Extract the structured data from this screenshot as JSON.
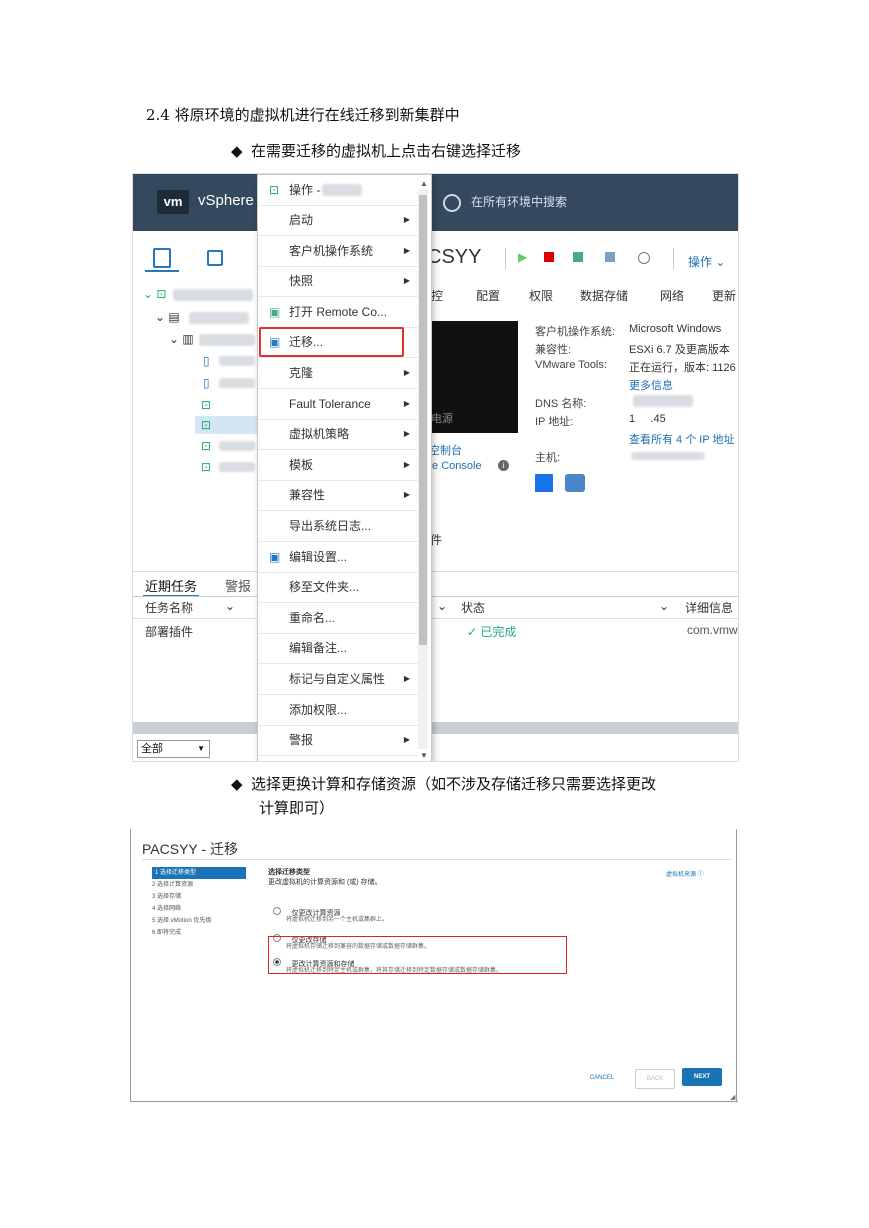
{
  "doc": {
    "heading": "2.4 将原环境的虚拟机进行在线迁移到新集群中",
    "bullet1": "在需要迁移的虚拟机上点击右键选择迁移",
    "bullet2_line1": "选择更换计算和存储资源（如不涉及存储迁移只需要选择更改",
    "bullet2_line2": "计算即可）",
    "bullet_glyph": "◆"
  },
  "shot1": {
    "app": "vSphere",
    "logo": "vm",
    "search_placeholder": "在所有环境中搜索",
    "vm_name": "CSYY",
    "ops_label": "操作 ⌄",
    "tabs": [
      "控",
      "配置",
      "权限",
      "数据存储",
      "网络",
      "更新"
    ],
    "info": {
      "os_label": "客户机操作系统:",
      "os_value": "Microsoft Windows",
      "compat_label": "兼容性:",
      "compat_value": "ESXi 6.7 及更高版本",
      "tools_label": "VMware Tools:",
      "tools_value": "正在运行，版本: 1126",
      "more_info": "更多信息",
      "dns_label": "DNS 名称:",
      "ip_label": "IP 地址:",
      "ip_value": "1     .45",
      "view_all_ip": "查看所有 4 个 IP 地址",
      "host_label": "主机:",
      "power_frag": "电源",
      "console_frag1": "空制台",
      "console_frag2": "te Console",
      "fragment_file": "件"
    },
    "recent_tasks": {
      "tab1": "近期任务",
      "tab2": "警报",
      "col_task": "任务名称",
      "col_status": "状态",
      "col_detail": "详细信息",
      "row_task": "部署插件",
      "row_status": "✓ 已完成",
      "row_detail": "com.vmwa",
      "filter": "全部"
    },
    "context_menu": {
      "header": "操作 -",
      "items": [
        {
          "label": "启动",
          "sub": true
        },
        {
          "label": "客户机操作系统",
          "sub": true
        },
        {
          "label": "快照",
          "sub": true
        },
        {
          "label": "打开 Remote Co...",
          "sub": false
        },
        {
          "label": "迁移...",
          "sub": false
        },
        {
          "label": "克隆",
          "sub": true
        },
        {
          "label": "Fault Tolerance",
          "sub": true
        },
        {
          "label": "虚拟机策略",
          "sub": true
        },
        {
          "label": "模板",
          "sub": true
        },
        {
          "label": "兼容性",
          "sub": true
        },
        {
          "label": "导出系统日志...",
          "sub": false
        },
        {
          "label": "编辑设置...",
          "sub": false
        },
        {
          "label": "移至文件夹...",
          "sub": false
        },
        {
          "label": "重命名...",
          "sub": false
        },
        {
          "label": "编辑备注...",
          "sub": false
        },
        {
          "label": "标记与自定义属性",
          "sub": true
        },
        {
          "label": "添加权限...",
          "sub": false
        },
        {
          "label": "警报",
          "sub": true
        }
      ]
    }
  },
  "shot2": {
    "title": "PACSYY - 迁移",
    "steps": [
      "1 选择迁移类型",
      "2 选择计算资源",
      "3 选择存储",
      "4 选择网络",
      "5 选择 vMotion 优先级",
      "6 即将完成"
    ],
    "section_title": "选择迁移类型",
    "section_sub": "更改虚拟机的计算资源和 (或) 存储。",
    "vm_origin": "虚拟机来源 ⓘ",
    "options": [
      {
        "label": "仅更改计算资源",
        "desc": "将虚拟机迁移到另一个主机或集群上。",
        "selected": false
      },
      {
        "label": "仅更改存储",
        "desc": "将虚拟机存储迁移到兼容的数据存储或数据存储群集。",
        "selected": false
      },
      {
        "label": "更改计算资源和存储",
        "desc": "将虚拟机迁移到特定主机或群集，将其存储迁移到特定数据存储或数据存储群集。",
        "selected": true
      }
    ],
    "buttons": {
      "cancel": "CANCEL",
      "back": "BACK",
      "next": "NEXT"
    }
  }
}
